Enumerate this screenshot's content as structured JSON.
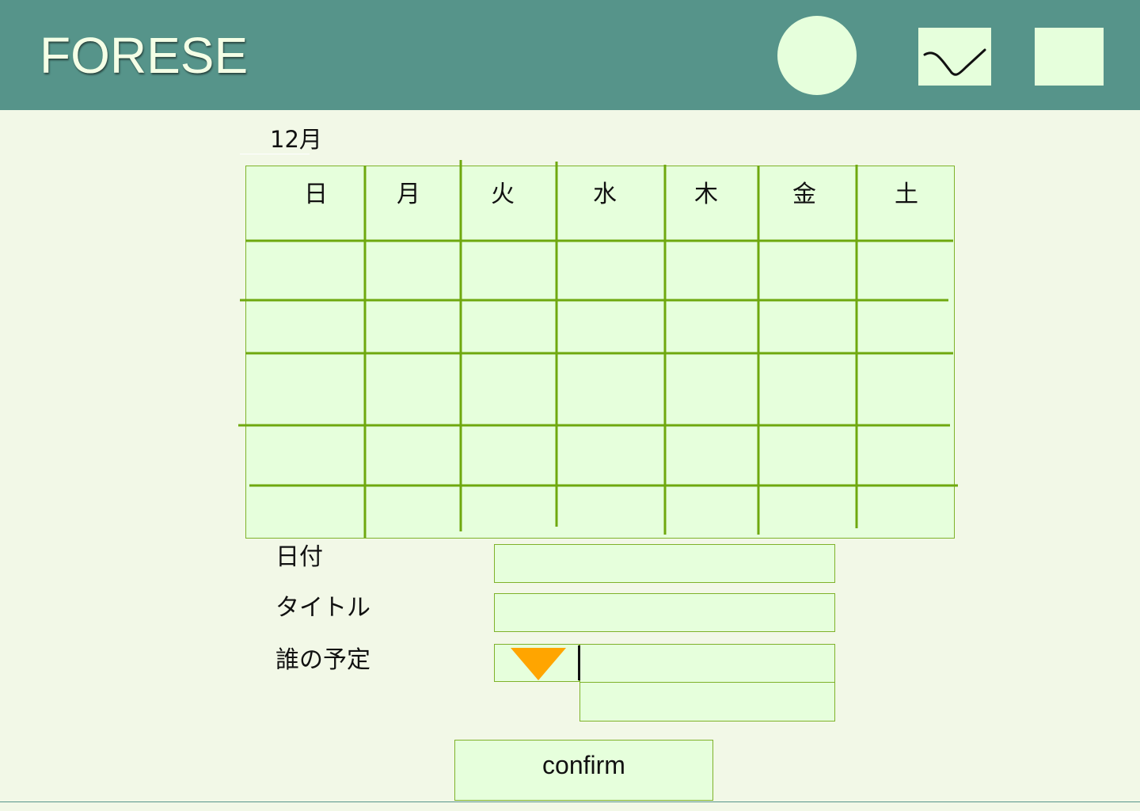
{
  "app": {
    "logo_text": "FORESE"
  },
  "header": {
    "icons": [
      "circle-icon",
      "check-icon",
      "square-icon"
    ]
  },
  "calendar": {
    "month_label": "12月",
    "weekdays": [
      "日",
      "月",
      "火",
      "水",
      "木",
      "金",
      "土"
    ],
    "row_count": 5
  },
  "form": {
    "date_label": "日付",
    "date_value": "",
    "title_label": "タイトル",
    "title_value": "",
    "who_label": "誰の予定",
    "who_value": "",
    "who_option_value": ""
  },
  "actions": {
    "confirm_label": "confirm"
  },
  "colors": {
    "header_bg": "#56948a",
    "page_bg": "#f2f8e7",
    "cell_bg": "#e6ffdc",
    "grid_line": "#6fa80f",
    "dropdown_arrow": "#ffa500"
  }
}
